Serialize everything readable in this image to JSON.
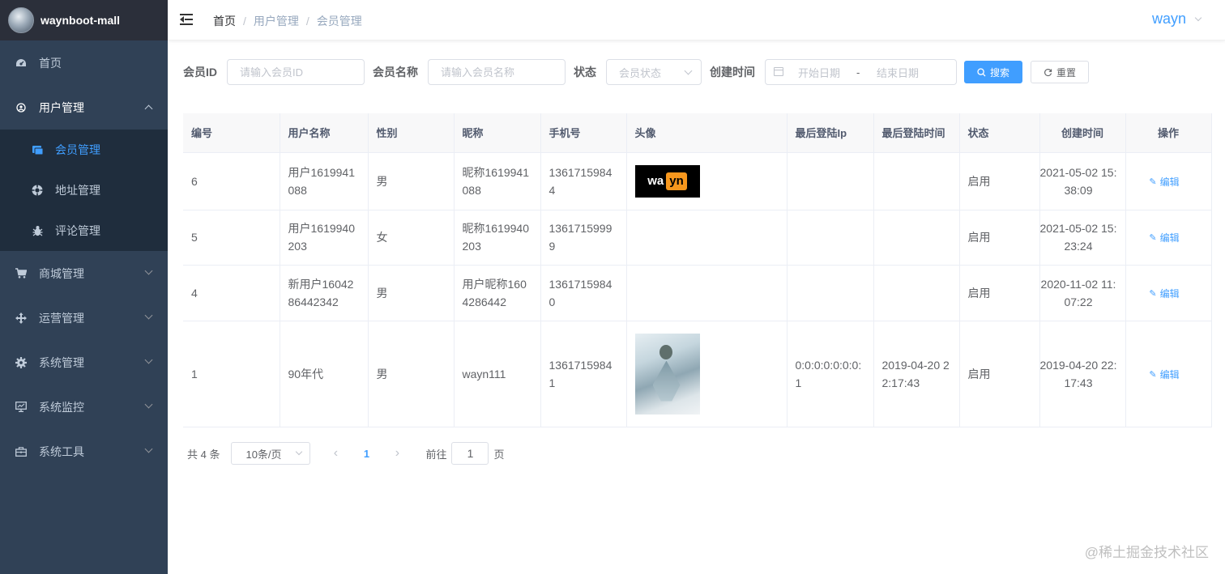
{
  "app": {
    "logo_title": "waynboot-mall"
  },
  "sidebar": {
    "menu": [
      {
        "label": "首页",
        "icon": "dashboard-icon"
      },
      {
        "label": "用户管理",
        "icon": "peoples-icon",
        "open": true,
        "children": [
          {
            "label": "会员管理",
            "icon": "member-card-icon",
            "active": true
          },
          {
            "label": "地址管理",
            "icon": "location-icon"
          },
          {
            "label": "评论管理",
            "icon": "bug-icon"
          }
        ]
      },
      {
        "label": "商城管理",
        "icon": "shopping-cart-icon"
      },
      {
        "label": "运营管理",
        "icon": "cross-move-icon"
      },
      {
        "label": "系统管理",
        "icon": "gear-icon"
      },
      {
        "label": "系统监控",
        "icon": "monitor-icon"
      },
      {
        "label": "系统工具",
        "icon": "toolbox-icon"
      }
    ]
  },
  "navbar": {
    "breadcrumb": [
      "首页",
      "用户管理",
      "会员管理"
    ],
    "separator": "/",
    "username": "wayn"
  },
  "search": {
    "member_id_label": "会员ID",
    "member_id_placeholder": "请输入会员ID",
    "member_name_label": "会员名称",
    "member_name_placeholder": "请输入会员名称",
    "status_label": "状态",
    "status_placeholder": "会员状态",
    "created_label": "创建时间",
    "start_placeholder": "开始日期",
    "range_separator": "-",
    "end_placeholder": "结束日期",
    "search_button": "搜索",
    "reset_button": "重置"
  },
  "table": {
    "headers": [
      "编号",
      "用户名称",
      "性别",
      "昵称",
      "手机号",
      "头像",
      "最后登陆Ip",
      "最后登陆时间",
      "状态",
      "创建时间",
      "操作"
    ],
    "rows": [
      {
        "id": "6",
        "username": "用户1619941088",
        "gender": "男",
        "nickname": "昵称1619941088",
        "phone": "13617159844",
        "avatar": "wayn-logo",
        "last_ip": "",
        "last_time": "",
        "status": "启用",
        "created": "2021-05-02 15:38:09",
        "action": "编辑"
      },
      {
        "id": "5",
        "username": "用户1619940203",
        "gender": "女",
        "nickname": "昵称1619940203",
        "phone": "13617159999",
        "avatar": "",
        "last_ip": "",
        "last_time": "",
        "status": "启用",
        "created": "2021-05-02 15:23:24",
        "action": "编辑"
      },
      {
        "id": "4",
        "username": "新用户1604286442342",
        "gender": "男",
        "nickname": "用户昵称1604286442",
        "phone": "13617159840",
        "avatar": "",
        "last_ip": "",
        "last_time": "",
        "status": "启用",
        "created": "2020-11-02 11:07:22",
        "action": "编辑"
      },
      {
        "id": "1",
        "username": "90年代",
        "gender": "男",
        "nickname": "wayn111",
        "phone": "13617159841",
        "avatar": "art-photo",
        "last_ip": "0:0:0:0:0:0:0:1",
        "last_time": "2019-04-20 22:17:43",
        "status": "启用",
        "created": "2019-04-20 22:17:43",
        "action": "编辑"
      }
    ],
    "avatar_logo": {
      "left": "wa",
      "right": "yn"
    }
  },
  "pagination": {
    "total_text": "共 4 条",
    "page_size": "10条/页",
    "current_page": "1",
    "jump_prefix": "前往",
    "jump_value": "1",
    "jump_suffix": "页"
  },
  "watermark": "@稀土掘金技术社区",
  "colors": {
    "primary": "#409eff",
    "sidebar_bg": "#304156",
    "submenu_bg": "#1f2d3d",
    "logo_bg": "#2b2f3a",
    "table_header_bg": "#f8f8f9"
  }
}
